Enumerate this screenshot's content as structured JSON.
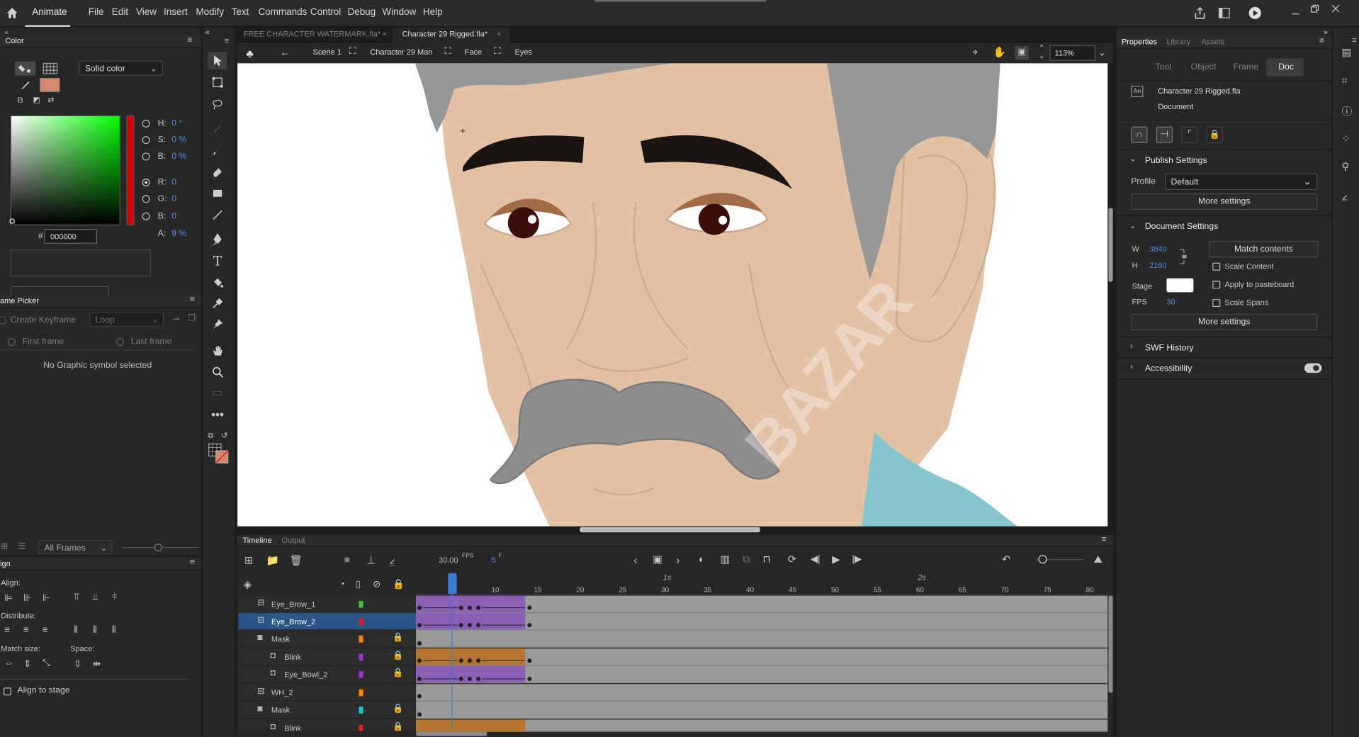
{
  "app": {
    "name": "Animate"
  },
  "menu": [
    "File",
    "Edit",
    "View",
    "Insert",
    "Modify",
    "Text",
    "Commands",
    "Control",
    "Debug",
    "Window",
    "Help"
  ],
  "color_panel": {
    "title": "Color",
    "fill_type": "Solid color",
    "hue": {
      "label": "H:",
      "value": "0 °"
    },
    "saturation": {
      "label": "S:",
      "value": "0 %"
    },
    "brightness": {
      "label": "B:",
      "value": "0 %"
    },
    "red": {
      "label": "R:",
      "value": "0"
    },
    "green": {
      "label": "G:",
      "value": "0"
    },
    "blue": {
      "label": "B:",
      "value": "0"
    },
    "alpha": {
      "label": "A:",
      "value": "9 %"
    },
    "hex_label": "#",
    "hex": "000000",
    "swatch_color": "#d7896c"
  },
  "frame_picker": {
    "title": "ame Picker",
    "create_keyframe": "Create Keyframe",
    "loop": "Loop",
    "first_frame": "First frame",
    "last_frame": "Last frame",
    "empty": "No Graphic symbol selected",
    "all_frames": "All Frames"
  },
  "align_panel": {
    "title": "ign",
    "align": "Align:",
    "distribute": "Distribute:",
    "match_size": "Match size:",
    "space": "Space:",
    "align_to_stage": "Align to stage"
  },
  "doc_tabs": [
    {
      "label": "FREE CHARACTER WATERMARK.fla*"
    },
    {
      "label": "Character 29 Rigged.fla*"
    }
  ],
  "breadcrumb": [
    "Scene 1",
    "Character 29 Man",
    "Face",
    "Eyes"
  ],
  "zoom": "113%",
  "stage": {
    "watermark": "BAZAR"
  },
  "timeline": {
    "tab": "Timeline",
    "output_tab": "Output",
    "fps": "30.00",
    "fps_unit": "FPS",
    "frame": "5",
    "frame_unit": "F",
    "time_labels": [
      "1s",
      "2s"
    ],
    "ticks": [
      "5",
      "10",
      "15",
      "20",
      "25",
      "30",
      "35",
      "40",
      "45",
      "50",
      "55",
      "60",
      "65",
      "70",
      "75",
      "80"
    ]
  },
  "layers": [
    {
      "name": "Eye_Brow_1",
      "color": "#3cbf3c",
      "locked": false,
      "selected": false
    },
    {
      "name": "Eye_Brow_2",
      "color": "#e02020",
      "locked": false,
      "selected": true
    },
    {
      "name": "Mask",
      "color": "#ff8800",
      "locked": true,
      "selected": false
    },
    {
      "name": "Blink",
      "color": "#9933cc",
      "locked": true,
      "selected": false
    },
    {
      "name": "Eye_Bowl_2",
      "color": "#9933cc",
      "locked": true,
      "selected": false
    },
    {
      "name": "WH_2",
      "color": "#ff8800",
      "locked": false,
      "selected": false
    },
    {
      "name": "Mask",
      "color": "#00cccc",
      "locked": true,
      "selected": false
    },
    {
      "name": "Blink",
      "color": "#e02020",
      "locked": true,
      "selected": false
    }
  ],
  "properties": {
    "tabs": [
      "Properties",
      "Library",
      "Assets"
    ],
    "sub_tabs": [
      "Tool",
      "Object",
      "Frame",
      "Doc"
    ],
    "active_sub_tab": "Doc",
    "doc_name": "Character 29 Rigged.fla",
    "doc_type": "Document",
    "doc_icon": "An",
    "publish_settings": "Publish Settings",
    "profile_label": "Profile",
    "profile_value": "Default",
    "more_settings": "More settings",
    "document_settings": "Document Settings",
    "w_label": "W",
    "w_value": "3840",
    "h_label": "H",
    "h_value": "2160",
    "match_contents": "Match contents",
    "scale_content": "Scale Content",
    "stage_label": "Stage",
    "stage_color": "#ffffff",
    "apply_to_pasteboard": "Apply to pasteboard",
    "fps_label": "FPS",
    "fps_value": "30",
    "scale_spans": "Scale Spans",
    "swf_history": "SWF History",
    "accessibility": "Accessibility"
  }
}
